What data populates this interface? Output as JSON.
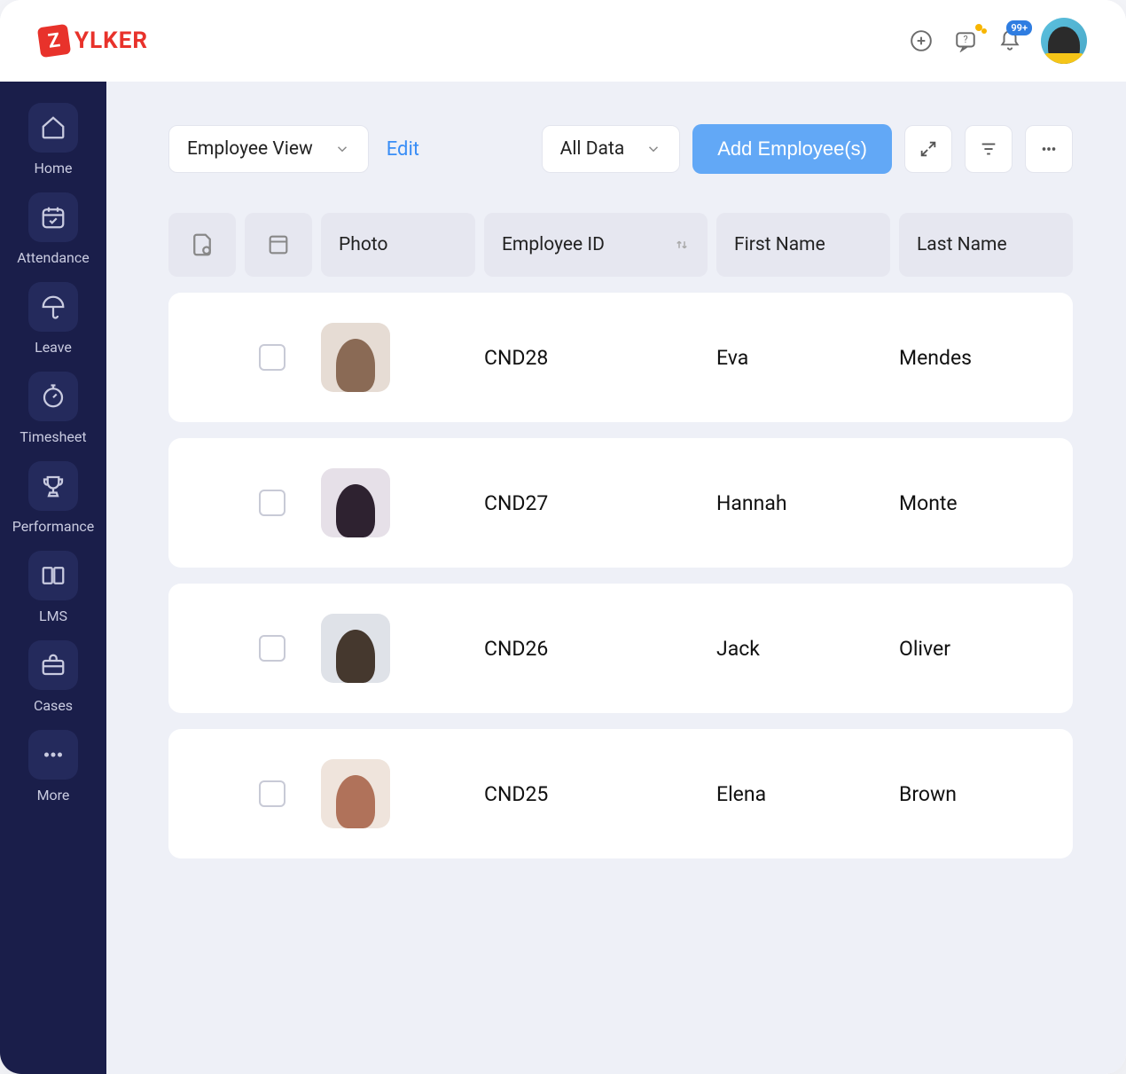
{
  "logo": {
    "badge": "Z",
    "text": "YLKER"
  },
  "header": {
    "notification_badge": "99+"
  },
  "sidebar": {
    "items": [
      {
        "label": "Home"
      },
      {
        "label": "Attendance"
      },
      {
        "label": "Leave"
      },
      {
        "label": "Timesheet"
      },
      {
        "label": "Performance"
      },
      {
        "label": "LMS"
      },
      {
        "label": "Cases"
      },
      {
        "label": "More"
      }
    ]
  },
  "toolbar": {
    "view_select": "Employee View",
    "edit": "Edit",
    "data_select": "All Data",
    "add_button": "Add Employee(s)"
  },
  "table": {
    "columns": {
      "photo": "Photo",
      "employee_id": "Employee ID",
      "first_name": "First Name",
      "last_name": "Last Name"
    },
    "rows": [
      {
        "employee_id": "CND28",
        "first_name": "Eva",
        "last_name": "Mendes",
        "photo_bg": "#e6dcd4",
        "photo_fg": "#8a6a55"
      },
      {
        "employee_id": "CND27",
        "first_name": "Hannah",
        "last_name": "Monte",
        "photo_bg": "#e6e0e8",
        "photo_fg": "#2e2230"
      },
      {
        "employee_id": "CND26",
        "first_name": "Jack",
        "last_name": "Oliver",
        "photo_bg": "#dfe2e8",
        "photo_fg": "#45382e"
      },
      {
        "employee_id": "CND25",
        "first_name": "Elena",
        "last_name": "Brown",
        "photo_bg": "#efe4dc",
        "photo_fg": "#b0725a"
      }
    ]
  }
}
